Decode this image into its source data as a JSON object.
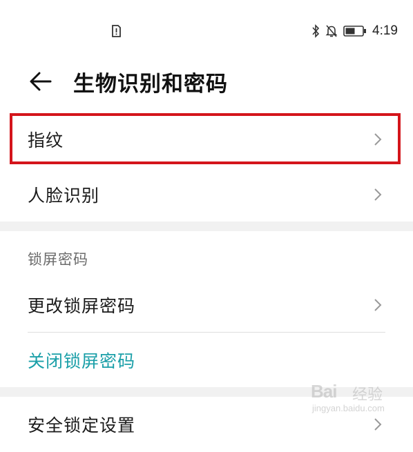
{
  "status_bar": {
    "time": "4:19",
    "icons": [
      "sim-alert-icon",
      "bluetooth-icon",
      "bell-off-icon",
      "battery-icon"
    ]
  },
  "header": {
    "back_icon": "arrow-left-icon",
    "title": "生物识别和密码"
  },
  "biometrics": {
    "items": [
      {
        "label": "指纹",
        "highlighted": true
      },
      {
        "label": "人脸识别"
      }
    ]
  },
  "lock_screen": {
    "section_title": "锁屏密码",
    "change_label": "更改锁屏密码",
    "disable_label": "关闭锁屏密码"
  },
  "security": {
    "lock_settings_label": "安全锁定设置"
  },
  "colors": {
    "highlight_border": "#d4151b",
    "accent_teal": "#1a9fa8",
    "section_gap": "#f1f1f1"
  },
  "watermark": {
    "logo": "Bai",
    "text": "经验",
    "url": "jingyan.baidu.com"
  }
}
